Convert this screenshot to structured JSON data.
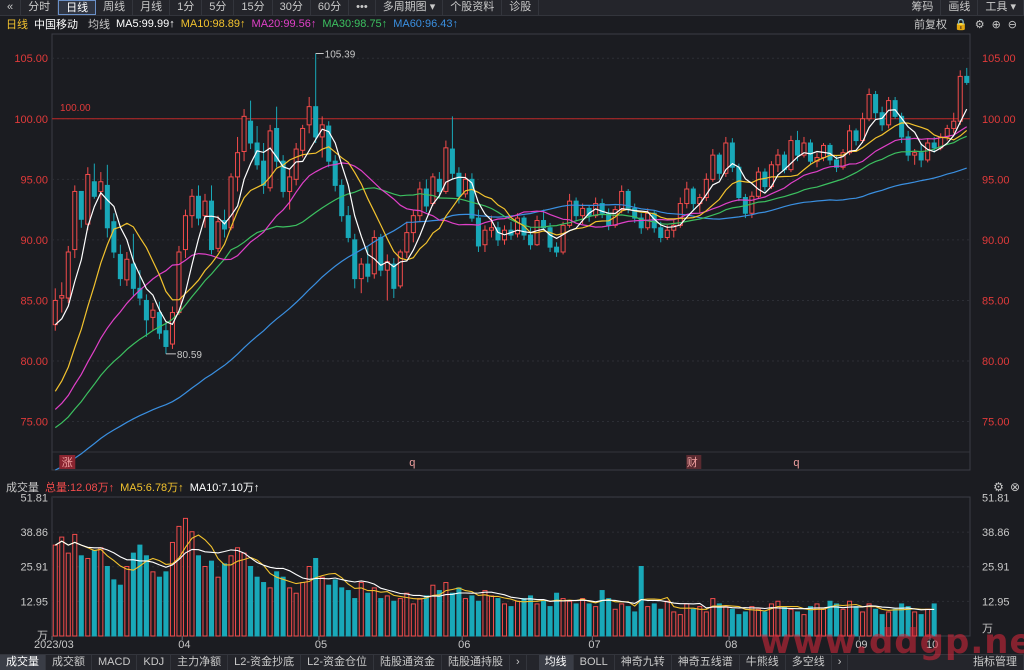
{
  "toolbar": {
    "back_icon": "«",
    "buttons": [
      "分时",
      "日线",
      "周线",
      "月线",
      "1分",
      "5分",
      "15分",
      "30分",
      "60分",
      "•••",
      "多周期图 ▾",
      "个股资料",
      "诊股"
    ],
    "active": "日线",
    "right": [
      "筹码",
      "画线",
      "工具 ▾"
    ]
  },
  "ma_header": {
    "period": "日线",
    "name": "中国移动",
    "avg": "均线",
    "ma5": "MA5:99.99↑",
    "ma10": "MA10:98.89↑",
    "ma20": "MA20:99.56↑",
    "ma30": "MA30:98.75↑",
    "ma60": "MA60:96.43↑",
    "fuquan": "前复权",
    "icons": [
      "lock-icon",
      "gear-icon",
      "add-icon",
      "minus-icon"
    ]
  },
  "vol_header": {
    "label": "成交量",
    "total": "总量:12.08万↑",
    "ma5": "MA5:6.78万↑",
    "ma10": "MA10:7.10万↑"
  },
  "colors": {
    "up": "#f24b4b",
    "down": "#19a8b8",
    "ma5": "#ffffff",
    "ma10": "#f2c22e",
    "ma20": "#e040c8",
    "ma30": "#3cc060",
    "ma60": "#3a8fe0",
    "ref": "#c02828"
  },
  "chart_data": [
    {
      "type": "candlestick",
      "yaxis": {
        "ticks": [
          "105.00",
          "100.00",
          "95.00",
          "90.00",
          "85.00",
          "80.00",
          "75.00"
        ],
        "range": [
          71,
          107
        ]
      },
      "xaxis": {
        "labels": [
          "2023/03",
          "04",
          "05",
          "06",
          "07",
          "08",
          "09",
          "10"
        ]
      },
      "ref_line": {
        "value": 100.0,
        "label": "100.00"
      },
      "annotations": {
        "high": "105.39",
        "low": "80.59",
        "markers": [
          "涨",
          "q",
          "财",
          "q"
        ]
      },
      "ohlc": [
        [
          83.0,
          86.0,
          82.5,
          85.0
        ],
        [
          85.2,
          86.5,
          84.0,
          85.4
        ],
        [
          85.2,
          89.5,
          84.8,
          89.0
        ],
        [
          89.2,
          94.5,
          88.5,
          94.0
        ],
        [
          94.0,
          94.0,
          91.0,
          91.7
        ],
        [
          91.3,
          96.0,
          90.8,
          95.4
        ],
        [
          94.8,
          96.3,
          93.4,
          93.6
        ],
        [
          94.0,
          95.6,
          92.5,
          94.8
        ],
        [
          94.5,
          96.2,
          90.2,
          91.0
        ],
        [
          91.5,
          92.2,
          88.5,
          89.0
        ],
        [
          88.8,
          89.6,
          86.2,
          86.8
        ],
        [
          86.7,
          89.0,
          86.2,
          88.4
        ],
        [
          88.0,
          90.5,
          85.4,
          86.0
        ],
        [
          86.0,
          87.5,
          84.6,
          85.2
        ],
        [
          85.0,
          85.5,
          82.0,
          83.4
        ],
        [
          83.6,
          84.8,
          82.5,
          84.2
        ],
        [
          84.0,
          84.9,
          81.8,
          82.3
        ],
        [
          82.5,
          83.2,
          80.59,
          81.2
        ],
        [
          81.4,
          84.5,
          81.0,
          84.0
        ],
        [
          84.0,
          89.5,
          83.8,
          89.0
        ],
        [
          89.2,
          92.5,
          88.5,
          92.0
        ],
        [
          92.0,
          94.2,
          91.0,
          93.6
        ],
        [
          93.6,
          94.5,
          91.2,
          91.8
        ],
        [
          92.0,
          93.8,
          91.0,
          93.2
        ],
        [
          93.2,
          94.5,
          88.8,
          89.2
        ],
        [
          89.3,
          92.0,
          89.0,
          91.5
        ],
        [
          91.6,
          92.5,
          90.2,
          90.9
        ],
        [
          91.0,
          95.5,
          90.8,
          95.2
        ],
        [
          95.2,
          98.5,
          94.0,
          97.2
        ],
        [
          97.3,
          100.8,
          96.5,
          100.2
        ],
        [
          99.8,
          101.5,
          97.5,
          98.0
        ],
        [
          98.0,
          99.4,
          95.8,
          96.2
        ],
        [
          96.5,
          98.0,
          93.8,
          94.5
        ],
        [
          94.3,
          99.5,
          94.0,
          99.0
        ],
        [
          99.2,
          101.0,
          96.0,
          96.5
        ],
        [
          96.5,
          97.0,
          93.5,
          94.0
        ],
        [
          94.0,
          95.8,
          92.5,
          95.2
        ],
        [
          95.0,
          98.0,
          94.5,
          97.5
        ],
        [
          97.4,
          99.5,
          96.8,
          99.2
        ],
        [
          99.5,
          101.8,
          98.8,
          101.0
        ],
        [
          101.0,
          105.39,
          98.0,
          98.5
        ],
        [
          98.5,
          100.2,
          96.8,
          99.5
        ],
        [
          99.4,
          99.8,
          96.0,
          96.5
        ],
        [
          96.5,
          97.0,
          94.0,
          94.5
        ],
        [
          94.5,
          95.0,
          91.5,
          92.0
        ],
        [
          92.0,
          92.8,
          89.8,
          90.2
        ],
        [
          90.0,
          90.5,
          86.0,
          86.8
        ],
        [
          86.8,
          88.5,
          85.6,
          88.0
        ],
        [
          88.0,
          89.4,
          86.5,
          87.0
        ],
        [
          87.2,
          90.8,
          86.8,
          90.2
        ],
        [
          90.2,
          90.5,
          87.0,
          87.5
        ],
        [
          87.5,
          88.8,
          85.0,
          88.2
        ],
        [
          88.0,
          88.5,
          85.2,
          86.0
        ],
        [
          86.2,
          89.2,
          86.0,
          89.0
        ],
        [
          89.0,
          91.5,
          88.5,
          90.6
        ],
        [
          90.6,
          92.5,
          89.8,
          92.0
        ],
        [
          92.0,
          94.8,
          91.5,
          94.2
        ],
        [
          94.2,
          95.0,
          92.3,
          92.8
        ],
        [
          93.0,
          95.5,
          92.8,
          95.2
        ],
        [
          95.0,
          95.6,
          93.5,
          94.0
        ],
        [
          94.0,
          98.2,
          93.8,
          97.6
        ],
        [
          97.5,
          100.2,
          95.0,
          95.5
        ],
        [
          95.5,
          96.0,
          93.0,
          93.6
        ],
        [
          93.8,
          95.5,
          93.5,
          95.0
        ],
        [
          95.0,
          95.5,
          91.5,
          91.8
        ],
        [
          91.8,
          92.5,
          89.0,
          89.5
        ],
        [
          89.6,
          91.2,
          89.0,
          90.8
        ],
        [
          90.8,
          92.0,
          90.2,
          91.0
        ],
        [
          91.0,
          91.5,
          89.5,
          90.0
        ],
        [
          90.0,
          91.2,
          89.6,
          90.8
        ],
        [
          90.8,
          91.5,
          90.0,
          90.4
        ],
        [
          90.5,
          92.2,
          90.2,
          91.8
        ],
        [
          91.8,
          92.0,
          90.0,
          90.4
        ],
        [
          90.4,
          91.0,
          89.2,
          89.6
        ],
        [
          89.6,
          92.0,
          89.5,
          91.6
        ],
        [
          91.6,
          92.5,
          90.8,
          91.0
        ],
        [
          91.0,
          91.4,
          89.0,
          89.4
        ],
        [
          89.4,
          89.8,
          88.6,
          89.0
        ],
        [
          89.0,
          91.5,
          88.8,
          91.2
        ],
        [
          91.2,
          93.8,
          91.0,
          93.2
        ],
        [
          93.2,
          93.5,
          91.6,
          92.0
        ],
        [
          92.0,
          93.0,
          91.3,
          92.6
        ],
        [
          92.6,
          92.8,
          91.5,
          92.0
        ],
        [
          92.0,
          93.5,
          91.8,
          93.0
        ],
        [
          93.0,
          93.4,
          91.8,
          92.2
        ],
        [
          92.2,
          92.6,
          90.8,
          91.2
        ],
        [
          91.2,
          92.8,
          91.0,
          92.5
        ],
        [
          92.5,
          94.5,
          92.2,
          94.0
        ],
        [
          94.0,
          94.2,
          92.2,
          92.6
        ],
        [
          92.6,
          93.0,
          91.4,
          91.8
        ],
        [
          91.8,
          92.2,
          90.5,
          91.0
        ],
        [
          91.0,
          92.6,
          90.8,
          92.2
        ],
        [
          92.2,
          92.4,
          90.6,
          91.0
        ],
        [
          91.0,
          91.5,
          89.8,
          90.2
        ],
        [
          90.2,
          91.2,
          90.0,
          90.8
        ],
        [
          90.8,
          91.6,
          90.2,
          91.2
        ],
        [
          91.2,
          93.5,
          91.0,
          93.0
        ],
        [
          93.0,
          94.8,
          92.6,
          94.2
        ],
        [
          94.2,
          94.4,
          92.5,
          93.0
        ],
        [
          93.0,
          93.8,
          92.2,
          93.5
        ],
        [
          93.5,
          95.5,
          93.2,
          95.0
        ],
        [
          95.0,
          97.5,
          94.8,
          97.0
        ],
        [
          97.0,
          97.2,
          95.0,
          95.5
        ],
        [
          95.5,
          98.5,
          95.2,
          98.0
        ],
        [
          98.0,
          98.4,
          95.6,
          96.0
        ],
        [
          96.0,
          96.3,
          93.2,
          93.5
        ],
        [
          93.5,
          93.8,
          91.8,
          92.2
        ],
        [
          92.2,
          94.0,
          91.8,
          93.6
        ],
        [
          93.6,
          96.0,
          93.4,
          95.6
        ],
        [
          95.6,
          95.9,
          94.0,
          94.4
        ],
        [
          94.4,
          96.5,
          94.2,
          96.2
        ],
        [
          96.2,
          97.5,
          95.6,
          97.0
        ],
        [
          97.0,
          97.3,
          95.5,
          95.8
        ],
        [
          95.8,
          98.6,
          95.6,
          98.2
        ],
        [
          98.2,
          99.0,
          96.5,
          97.0
        ],
        [
          97.0,
          98.5,
          96.8,
          98.0
        ],
        [
          98.0,
          98.3,
          96.2,
          96.5
        ],
        [
          96.5,
          97.2,
          96.0,
          96.8
        ],
        [
          96.8,
          98.0,
          96.5,
          97.8
        ],
        [
          97.8,
          98.0,
          96.2,
          96.6
        ],
        [
          96.6,
          97.0,
          95.6,
          96.0
        ],
        [
          96.0,
          97.5,
          95.8,
          97.2
        ],
        [
          97.2,
          99.5,
          97.0,
          99.0
        ],
        [
          99.0,
          99.2,
          97.8,
          98.2
        ],
        [
          98.2,
          100.5,
          98.0,
          100.0
        ],
        [
          100.0,
          102.5,
          99.8,
          102.0
        ],
        [
          102.0,
          102.3,
          100.0,
          100.5
        ],
        [
          100.5,
          101.0,
          99.0,
          99.5
        ],
        [
          99.5,
          101.8,
          99.2,
          101.5
        ],
        [
          101.5,
          101.8,
          100.0,
          100.2
        ],
        [
          100.2,
          100.5,
          98.0,
          98.5
        ],
        [
          98.5,
          99.0,
          96.5,
          97.0
        ],
        [
          97.0,
          97.5,
          96.2,
          97.2
        ],
        [
          97.2,
          98.0,
          96.0,
          96.6
        ],
        [
          96.6,
          98.4,
          96.4,
          98.0
        ],
        [
          98.0,
          98.5,
          97.2,
          97.6
        ],
        [
          97.6,
          98.8,
          97.4,
          98.5
        ],
        [
          98.5,
          99.5,
          98.2,
          99.2
        ],
        [
          99.2,
          100.5,
          98.8,
          99.8
        ],
        [
          99.8,
          104.0,
          99.5,
          103.5
        ],
        [
          103.5,
          104.2,
          102.8,
          103.0
        ]
      ]
    },
    {
      "type": "volume",
      "unit": "万",
      "yaxis": {
        "ticks": [
          "51.81",
          "38.86",
          "25.91",
          "12.95"
        ],
        "max": 52
      },
      "volumes": [
        34,
        37,
        31,
        38,
        30,
        29,
        32,
        33,
        26,
        21,
        19,
        26,
        31,
        34,
        30,
        24,
        22,
        24,
        35,
        41,
        44,
        39,
        30,
        26,
        28,
        22,
        27,
        30,
        33,
        31,
        26,
        22,
        20,
        18,
        24,
        22,
        18,
        16,
        20,
        26,
        29,
        22,
        19,
        21,
        18,
        17,
        14,
        20,
        16,
        18,
        14,
        15,
        13,
        14,
        16,
        12,
        14,
        15,
        19,
        17,
        20,
        16,
        18,
        14,
        15,
        13,
        17,
        15,
        14,
        12,
        11,
        13,
        14,
        15,
        12,
        13,
        11,
        16,
        14,
        13,
        12,
        14,
        12,
        11,
        17,
        14,
        10,
        12,
        11,
        9,
        26,
        11,
        12,
        10,
        13,
        9,
        8,
        12,
        10,
        11,
        9,
        14,
        12,
        11,
        10,
        8,
        9,
        11,
        10,
        9,
        12,
        13,
        11,
        10,
        9,
        8,
        11,
        12,
        10,
        13,
        12,
        10,
        13,
        11,
        9,
        12,
        10,
        8,
        9,
        10,
        12,
        11,
        9,
        8,
        10,
        12
      ]
    }
  ],
  "bottom_tabs": {
    "left": [
      "成交量",
      "成交额",
      "MACD",
      "KDJ",
      "主力净额",
      "L2-资金抄底",
      "L2-资金仓位",
      "陆股通资金",
      "陆股通持股"
    ],
    "active_left": "成交量",
    "right": [
      "均线",
      "BOLL",
      "神奇九转",
      "神奇五线谱",
      "牛熊线",
      "多空线"
    ],
    "active_right": "均线",
    "far_right": "指标管理"
  },
  "watermark": "www.ddgp.net"
}
